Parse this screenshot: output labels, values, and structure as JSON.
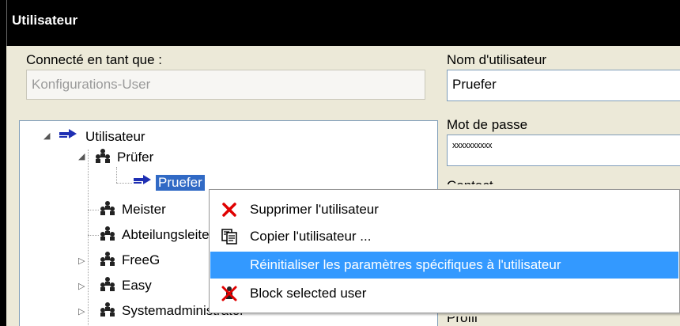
{
  "window": {
    "title": "Utilisateur"
  },
  "login": {
    "label": "Connecté en tant que :",
    "value": "Konfigurations-User"
  },
  "username": {
    "label": "Nom d'utilisateur",
    "value": "Pruefer"
  },
  "password": {
    "label": "Mot de passe",
    "value": "xxxxxxxxxx"
  },
  "contact": {
    "label": "Contact"
  },
  "profile": {
    "label": "Profil"
  },
  "tree": {
    "root": "Utilisateur",
    "groups": [
      "Prüfer",
      "Meister",
      "Abteilungsleiter",
      "FreeG",
      "Easy",
      "Systemadministrator"
    ],
    "selected_user": "Pruefer"
  },
  "context_menu": {
    "items": [
      {
        "label": "Supprimer l'utilisateur",
        "icon": "delete-icon"
      },
      {
        "label": "Copier l'utilisateur ...",
        "icon": "copy-icon"
      },
      {
        "label": "Réinitialiser les paramètres spécifiques à l'utilisateur",
        "icon": ""
      },
      {
        "label": "Block selected user",
        "icon": "block-user-icon"
      }
    ],
    "highlighted_index": 2
  },
  "colors": {
    "selection": "#316ac5",
    "menu_highlight": "#3399ff",
    "delete_red": "#e00000"
  }
}
